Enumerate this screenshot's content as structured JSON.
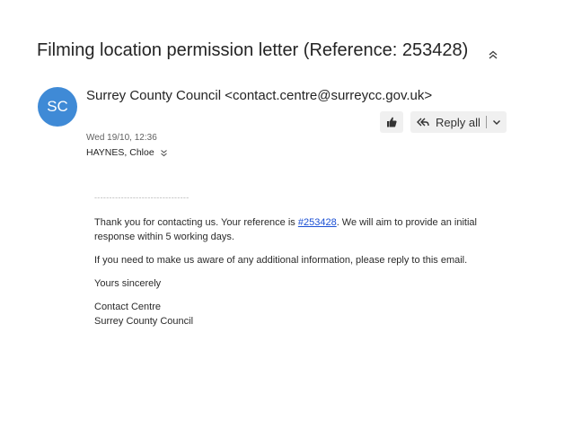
{
  "email": {
    "subject": "Filming location permission letter (Reference: 253428)",
    "sender": {
      "initials": "SC",
      "display": "Surrey County Council <contact.centre@surreycc.gov.uk>",
      "avatar_color": "#3f8ad6"
    },
    "date": "Wed 19/10, 12:36",
    "recipient": "HAYNES, Chloe",
    "actions": {
      "thumb_icon": "thumbs-up-icon",
      "reply_icon": "reply-all-icon",
      "reply_all_label": "Reply all",
      "more_icon": "chevron-down-icon"
    },
    "body": {
      "dashes": "--------------------------------",
      "p1_before": "Thank you for contacting us. Your reference is ",
      "p1_link": "#253428",
      "p1_after": ". We will aim to provide an initial response within 5 working days.",
      "p2": "If you need to make us aware of any additional information, please reply to this email.",
      "p3": "Yours sincerely",
      "signature_line1": "Contact Centre",
      "signature_line2": "Surrey County Council"
    },
    "link_color": "#1a4fd4"
  }
}
